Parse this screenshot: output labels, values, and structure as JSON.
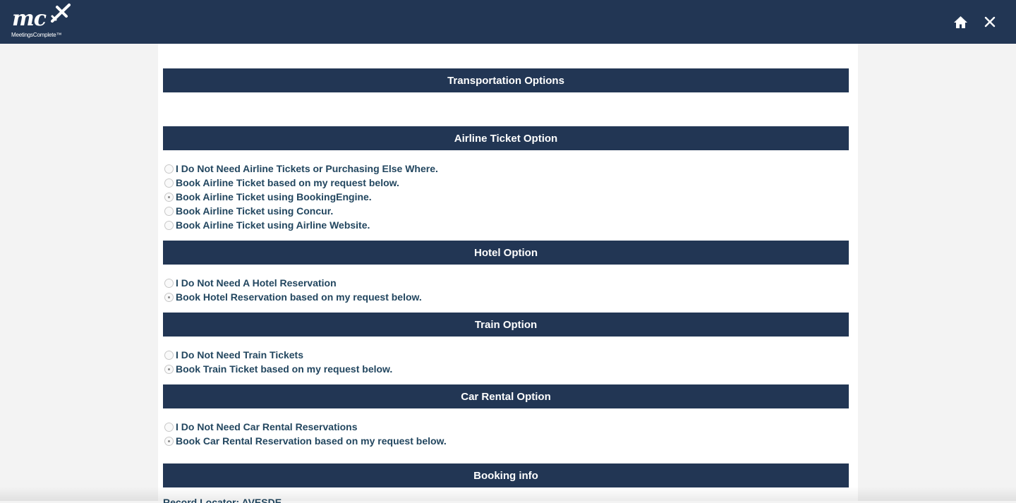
{
  "header": {
    "logo_mark": "mc",
    "logo_sub": "MeetingsComplete™",
    "home_icon": "home-icon",
    "close_icon": "close-icon",
    "bar_color": "#223654"
  },
  "sections": {
    "transportation": {
      "title": "Transportation Options"
    },
    "airline": {
      "title": "Airline Ticket Option",
      "options": [
        {
          "label": "I Do Not Need Airline Tickets or Purchasing Else Where.",
          "checked": false
        },
        {
          "label": "Book Airline Ticket based on my request below.",
          "checked": false
        },
        {
          "label": "Book Airline Ticket using BookingEngine.",
          "checked": true
        },
        {
          "label": "Book Airline Ticket using Concur.",
          "checked": false
        },
        {
          "label": "Book Airline Ticket using Airline Website.",
          "checked": false
        }
      ]
    },
    "hotel": {
      "title": "Hotel Option",
      "options": [
        {
          "label": "I Do Not Need A Hotel Reservation",
          "checked": false
        },
        {
          "label": "Book Hotel Reservation based on my request below.",
          "checked": true
        }
      ]
    },
    "train": {
      "title": "Train Option",
      "options": [
        {
          "label": "I Do Not Need Train Tickets",
          "checked": false
        },
        {
          "label": "Book Train Ticket based on my request below.",
          "checked": true
        }
      ]
    },
    "car": {
      "title": "Car Rental Option",
      "options": [
        {
          "label": "I Do Not Need Car Rental Reservations",
          "checked": false
        },
        {
          "label": "Book Car Rental Reservation based on my request below.",
          "checked": true
        }
      ]
    },
    "booking": {
      "title": "Booking info",
      "cut_text": "Record Locator: AVESDE"
    }
  }
}
